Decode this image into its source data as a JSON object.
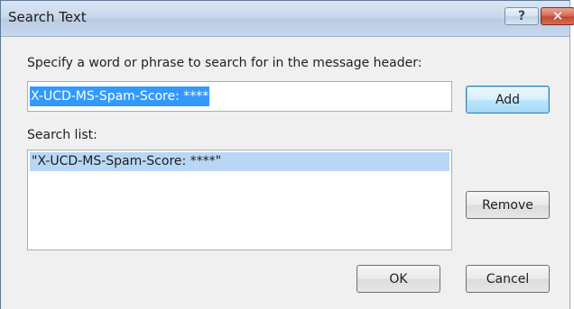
{
  "window": {
    "title": "Search Text",
    "help_label": "?",
    "close_label": "✕"
  },
  "prompt": {
    "label": "Specify a word or phrase to search for in the message header:",
    "input_value": "X-UCD-MS-Spam-Score: ****"
  },
  "buttons": {
    "add": "Add",
    "remove": "Remove",
    "ok": "OK",
    "cancel": "Cancel"
  },
  "search_list": {
    "label": "Search list:",
    "items": [
      {
        "text": "\"X-UCD-MS-Spam-Score: ****\"",
        "selected": true
      }
    ]
  },
  "colors": {
    "selection": "#3399ff",
    "list_selection": "#b9d7f5",
    "dialog_bg": "#f0f0f0"
  }
}
